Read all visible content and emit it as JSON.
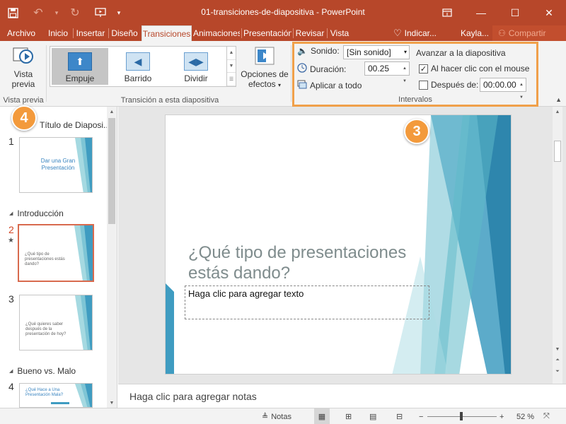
{
  "app": {
    "window_title": "01-transiciones-de-diapositiva - PowerPoint"
  },
  "tabs": [
    {
      "label": "Archivo"
    },
    {
      "label": "Inicio"
    },
    {
      "label": "Insertar"
    },
    {
      "label": "Diseño"
    },
    {
      "label": "Transiciones",
      "active": true
    },
    {
      "label": "Animaciones"
    },
    {
      "label": "Presentación"
    },
    {
      "label": "Revisar"
    },
    {
      "label": "Vista"
    }
  ],
  "tell_me": "Indicar...",
  "user": "Kayla...",
  "share": "Compartir",
  "ribbon": {
    "preview": {
      "label_1": "Vista",
      "label_2": "previa",
      "group_label": "Vista previa"
    },
    "gallery": {
      "items": [
        {
          "label": "Empuje",
          "selected": true
        },
        {
          "label": "Barrido"
        },
        {
          "label": "Dividir"
        }
      ],
      "group_label": "Transición a esta diapositiva"
    },
    "effect_options": {
      "label_1": "Opciones de",
      "label_2": "efectos"
    },
    "timing": {
      "sound_label": "Sonido:",
      "sound_value": "[Sin sonido]",
      "duration_label": "Duración:",
      "duration_value": "00.25",
      "apply_all": "Aplicar a todo",
      "advance_header": "Avanzar a la diapositiva",
      "on_click_label": "Al hacer clic con el mouse",
      "on_click_checked": true,
      "after_label": "Después de:",
      "after_value": "00:00.00",
      "after_checked": false,
      "group_label": "Intervalos"
    }
  },
  "badges": {
    "preview": "4",
    "timing": "3"
  },
  "sidebar": {
    "sections": [
      {
        "label": "Título de Diaposi..."
      },
      {
        "label": "Introducción"
      },
      {
        "label": "Bueno vs. Malo"
      }
    ],
    "slides": [
      {
        "num": "1",
        "text": "Dar una Gran Presentación"
      },
      {
        "num": "2",
        "text": "¿Qué tipo de presentaciones estás dando?"
      },
      {
        "num": "3",
        "text": "¿Qué quieres saber después de la presentación de hoy?"
      },
      {
        "num": "4",
        "text": "¿Qué Hace a Una Presentación Mala?"
      }
    ]
  },
  "slide": {
    "title": "¿Qué tipo de presentaciones estás dando?",
    "body_placeholder": "Haga clic para agregar texto"
  },
  "notes_placeholder": "Haga clic para agregar notas",
  "status": {
    "notes_label": "Notas",
    "zoom": "52 %"
  },
  "colors": {
    "accent": "#b7472a",
    "highlight": "#f0a04a",
    "slide_art_1": "#3f9cc1",
    "slide_art_2": "#5fb9c9"
  }
}
